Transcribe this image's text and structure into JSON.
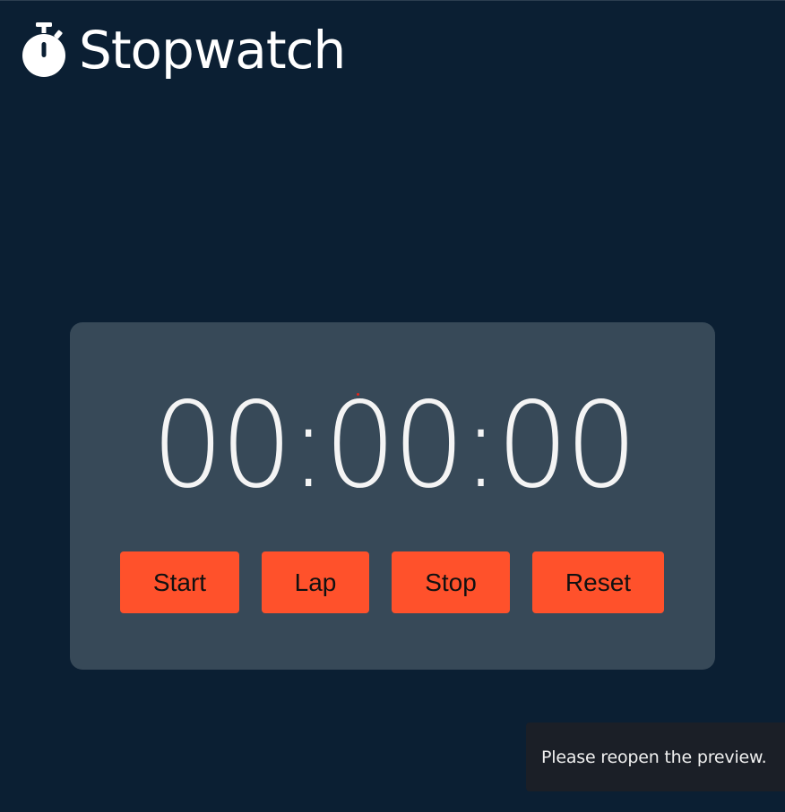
{
  "header": {
    "icon": "stopwatch-icon",
    "title": "Stopwatch"
  },
  "timer": {
    "display": "00:00:00"
  },
  "controls": {
    "start_label": "Start",
    "lap_label": "Lap",
    "stop_label": "Stop",
    "reset_label": "Reset"
  },
  "toast": {
    "message": "Please reopen the preview."
  },
  "colors": {
    "background": "#0b1f33",
    "card": "#374958",
    "accent": "#ff512b",
    "toast_background": "#1b1f27"
  }
}
